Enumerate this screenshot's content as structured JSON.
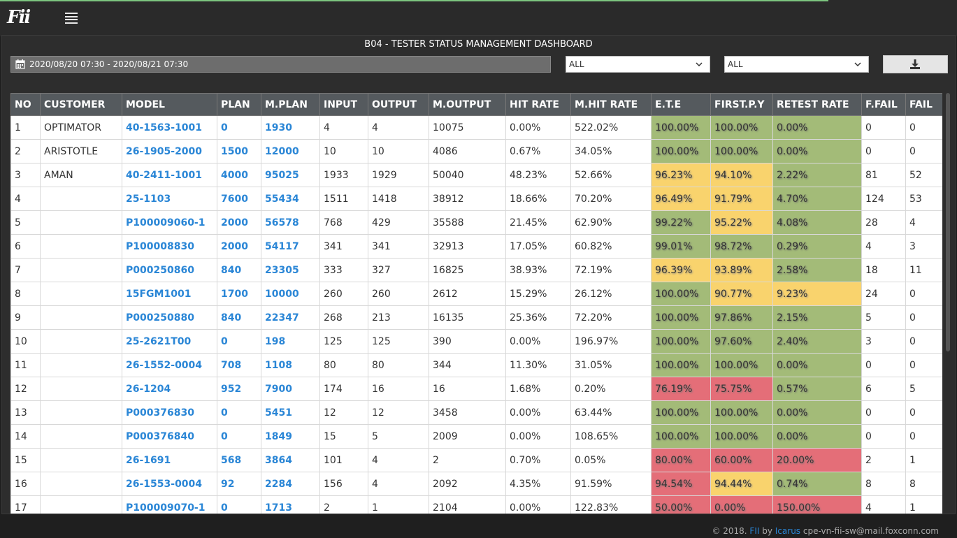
{
  "app": {
    "logo_text": "Fii"
  },
  "dashboard": {
    "title": "B04 - TESTER STATUS MANAGEMENT DASHBOARD"
  },
  "filters": {
    "date_range": "2020/08/20 07:30 - 2020/08/21 07:30",
    "select1": "ALL",
    "select2": "ALL"
  },
  "colors": {
    "green": "#a3bb78",
    "yellow": "#f9d36d",
    "red": "#e46e78",
    "link": "#2a86d6"
  },
  "table": {
    "headers": [
      "NO",
      "CUSTOMER",
      "MODEL",
      "PLAN",
      "M.PLAN",
      "INPUT",
      "OUTPUT",
      "M.OUTPUT",
      "HIT RATE",
      "M.HIT RATE",
      "E.T.E",
      "FIRST.P.Y",
      "RETEST RATE",
      "F.FAIL",
      "FAIL"
    ],
    "rows": [
      [
        "1",
        "OPTIMATOR",
        "40-1563-1001",
        "0",
        "1930",
        "4",
        "4",
        "10075",
        "0.00%",
        "522.02%",
        "100.00%",
        "100.00%",
        "0.00%",
        "0",
        "0"
      ],
      [
        "2",
        "ARISTOTLE",
        "26-1905-2000",
        "1500",
        "12000",
        "10",
        "10",
        "4086",
        "0.67%",
        "34.05%",
        "100.00%",
        "100.00%",
        "0.00%",
        "0",
        "0"
      ],
      [
        "3",
        "AMAN",
        "40-2411-1001",
        "4000",
        "95025",
        "1933",
        "1929",
        "50040",
        "48.23%",
        "52.66%",
        "96.23%",
        "94.10%",
        "2.22%",
        "81",
        "52"
      ],
      [
        "4",
        "",
        "25-1103",
        "7600",
        "55434",
        "1511",
        "1418",
        "38912",
        "18.66%",
        "70.20%",
        "96.49%",
        "91.79%",
        "4.70%",
        "124",
        "53"
      ],
      [
        "5",
        "",
        "P100009060-1",
        "2000",
        "56578",
        "768",
        "429",
        "35588",
        "21.45%",
        "62.90%",
        "99.22%",
        "95.22%",
        "4.08%",
        "28",
        "4"
      ],
      [
        "6",
        "",
        "P100008830",
        "2000",
        "54117",
        "341",
        "341",
        "32913",
        "17.05%",
        "60.82%",
        "99.01%",
        "98.72%",
        "0.29%",
        "4",
        "3"
      ],
      [
        "7",
        "",
        "P000250860",
        "840",
        "23305",
        "333",
        "327",
        "16825",
        "38.93%",
        "72.19%",
        "96.39%",
        "93.89%",
        "2.58%",
        "18",
        "11"
      ],
      [
        "8",
        "",
        "15FGM1001",
        "1700",
        "10000",
        "260",
        "260",
        "2612",
        "15.29%",
        "26.12%",
        "100.00%",
        "90.77%",
        "9.23%",
        "24",
        "0"
      ],
      [
        "9",
        "",
        "P000250880",
        "840",
        "22347",
        "268",
        "213",
        "16135",
        "25.36%",
        "72.20%",
        "100.00%",
        "97.86%",
        "2.15%",
        "5",
        "0"
      ],
      [
        "10",
        "",
        "25-2621T00",
        "0",
        "198",
        "125",
        "125",
        "390",
        "0.00%",
        "196.97%",
        "100.00%",
        "97.60%",
        "2.40%",
        "3",
        "0"
      ],
      [
        "11",
        "",
        "26-1552-0004",
        "708",
        "1108",
        "80",
        "80",
        "344",
        "11.30%",
        "31.05%",
        "100.00%",
        "100.00%",
        "0.00%",
        "0",
        "0"
      ],
      [
        "12",
        "",
        "26-1204",
        "952",
        "7900",
        "174",
        "16",
        "16",
        "1.68%",
        "0.20%",
        "76.19%",
        "75.75%",
        "0.57%",
        "6",
        "5"
      ],
      [
        "13",
        "",
        "P000376830",
        "0",
        "5451",
        "12",
        "12",
        "3458",
        "0.00%",
        "63.44%",
        "100.00%",
        "100.00%",
        "0.00%",
        "0",
        "0"
      ],
      [
        "14",
        "",
        "P000376840",
        "0",
        "1849",
        "15",
        "5",
        "2009",
        "0.00%",
        "108.65%",
        "100.00%",
        "100.00%",
        "0.00%",
        "0",
        "0"
      ],
      [
        "15",
        "",
        "26-1691",
        "568",
        "3864",
        "101",
        "4",
        "2",
        "0.70%",
        "0.05%",
        "80.00%",
        "60.00%",
        "20.00%",
        "2",
        "1"
      ],
      [
        "16",
        "",
        "26-1553-0004",
        "92",
        "2284",
        "156",
        "4",
        "2092",
        "4.35%",
        "91.59%",
        "94.54%",
        "94.44%",
        "0.74%",
        "8",
        "8"
      ],
      [
        "17",
        "",
        "P100009070-1",
        "0",
        "1713",
        "2",
        "1",
        "2104",
        "0.00%",
        "122.83%",
        "50.00%",
        "0.00%",
        "150.00%",
        "4",
        "1"
      ]
    ],
    "status": [
      [
        "green",
        "green",
        "green"
      ],
      [
        "green",
        "green",
        "green"
      ],
      [
        "yellow",
        "yellow",
        "green"
      ],
      [
        "yellow",
        "yellow",
        "green"
      ],
      [
        "green",
        "yellow",
        "green"
      ],
      [
        "green",
        "green",
        "green"
      ],
      [
        "yellow",
        "yellow",
        "green"
      ],
      [
        "green",
        "yellow",
        "yellow"
      ],
      [
        "green",
        "green",
        "green"
      ],
      [
        "green",
        "green",
        "green"
      ],
      [
        "green",
        "green",
        "green"
      ],
      [
        "red",
        "red",
        "green"
      ],
      [
        "green",
        "green",
        "green"
      ],
      [
        "green",
        "green",
        "green"
      ],
      [
        "red",
        "red",
        "red"
      ],
      [
        "red",
        "yellow",
        "green"
      ],
      [
        "red",
        "red",
        "red"
      ]
    ]
  },
  "footer": {
    "prefix": "© 2018. ",
    "brand": "FII",
    "by": " by ",
    "author": "Icarus",
    "email": " cpe-vn-fii-sw@mail.foxconn.com"
  }
}
